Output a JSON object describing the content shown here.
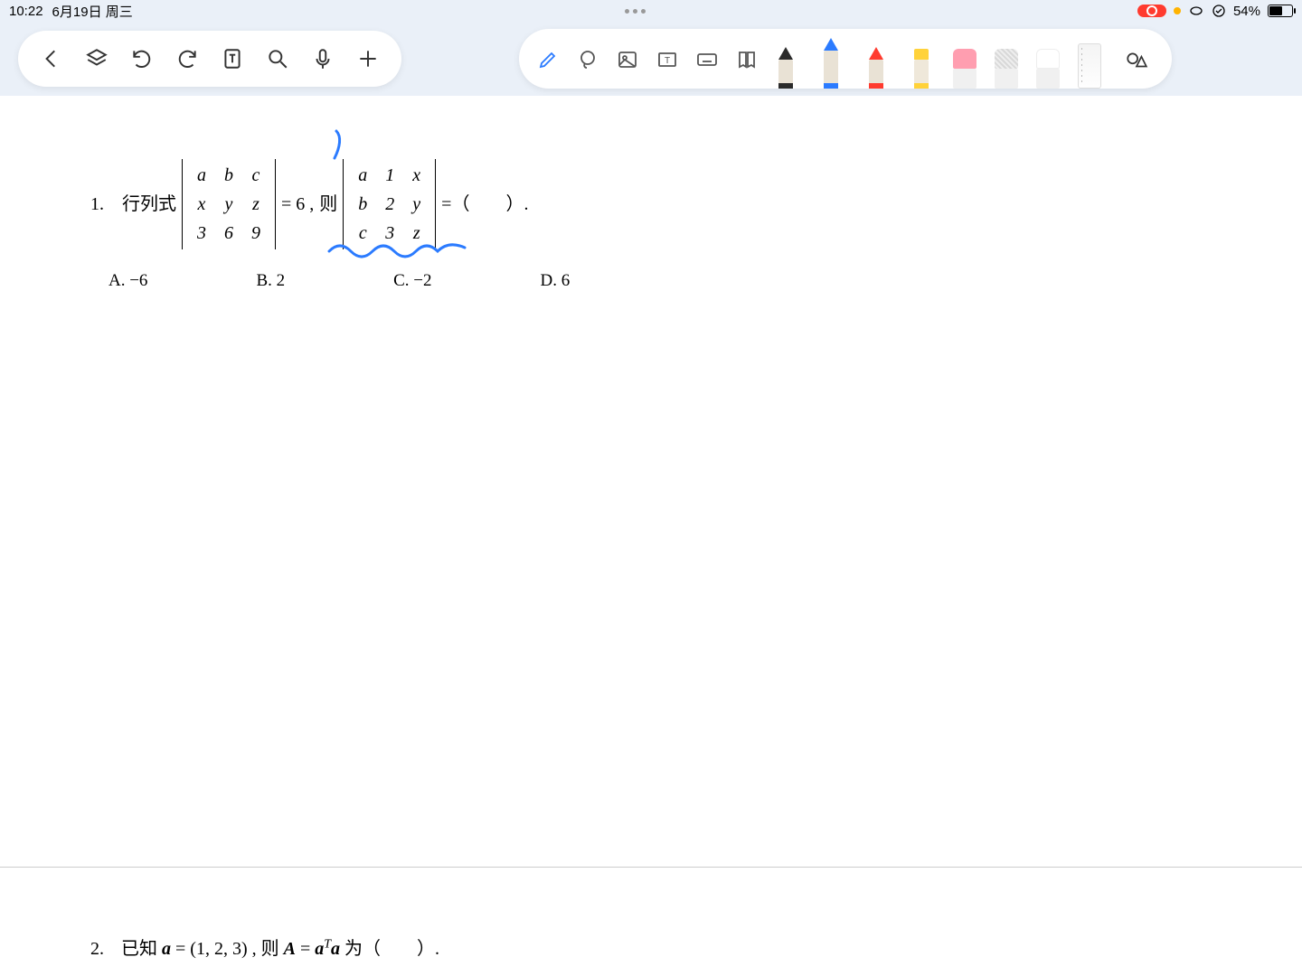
{
  "status": {
    "time": "10:22",
    "date": "6月19日 周三",
    "battery_pct": "54%"
  },
  "tools": {
    "pen_colors": {
      "black": "#2b2b2b",
      "blue": "#2b7bff",
      "red": "#ff3b2f",
      "yellow": "#ffd23a",
      "pink": "#ff9eb0",
      "gray": "#c9c9c9"
    }
  },
  "question1": {
    "number": "1.",
    "label": "行列式",
    "det1": [
      [
        "a",
        "b",
        "c"
      ],
      [
        "x",
        "y",
        "z"
      ],
      [
        "3",
        "6",
        "9"
      ]
    ],
    "eq1": "= 6 ,",
    "then": "则",
    "det2": [
      [
        "a",
        "1",
        "x"
      ],
      [
        "b",
        "2",
        "y"
      ],
      [
        "c",
        "3",
        "z"
      ]
    ],
    "eq2": "=（　　）.",
    "options": {
      "A": "A.  −6",
      "B": "B. 2",
      "C": "C. −2",
      "D": "D. 6"
    }
  },
  "question2": {
    "number": "2.",
    "prefix": "已知 ",
    "vec": "a",
    "value": " = (1, 2, 3) ,",
    "then": " 则 ",
    "mat": "A",
    "expr_eq": " = ",
    "expr_a1": "a",
    "expr_sup": "T",
    "expr_a2": "a",
    "suffix": "  为（　　）."
  }
}
